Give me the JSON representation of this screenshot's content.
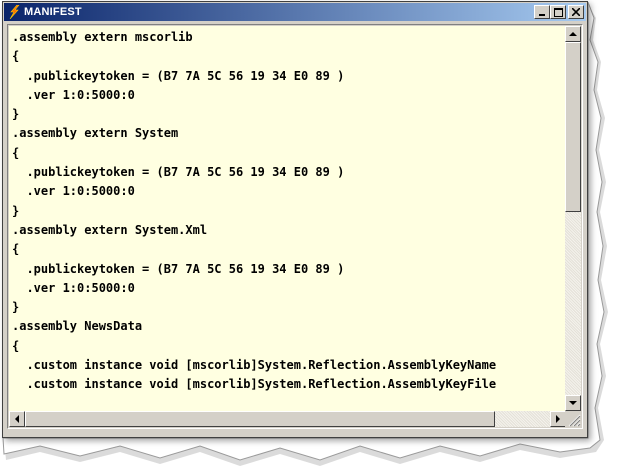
{
  "window": {
    "title": "MANIFEST",
    "title_color": "#ffffff",
    "titlebar_gradient": [
      "#0a246a",
      "#a6caf0"
    ],
    "background_color": "#ffffe1"
  },
  "icons": {
    "app": "lightning-icon",
    "minimize": "minimize-icon",
    "maximize": "maximize-icon",
    "close": "close-icon",
    "scroll_up": "arrow-up-icon",
    "scroll_down": "arrow-down-icon",
    "scroll_left": "arrow-left-icon",
    "scroll_right": "arrow-right-icon"
  },
  "code_lines": [
    ".assembly extern mscorlib",
    "{",
    "  .publickeytoken = (B7 7A 5C 56 19 34 E0 89 )",
    "  .ver 1:0:5000:0",
    "}",
    ".assembly extern System",
    "{",
    "  .publickeytoken = (B7 7A 5C 56 19 34 E0 89 )",
    "  .ver 1:0:5000:0",
    "}",
    ".assembly extern System.Xml",
    "{",
    "  .publickeytoken = (B7 7A 5C 56 19 34 E0 89 )",
    "  .ver 1:0:5000:0",
    "}",
    ".assembly NewsData",
    "{",
    "  .custom instance void [mscorlib]System.Reflection.AssemblyKeyName",
    "  .custom instance void [mscorlib]System.Reflection.AssemblyKeyFile"
  ]
}
